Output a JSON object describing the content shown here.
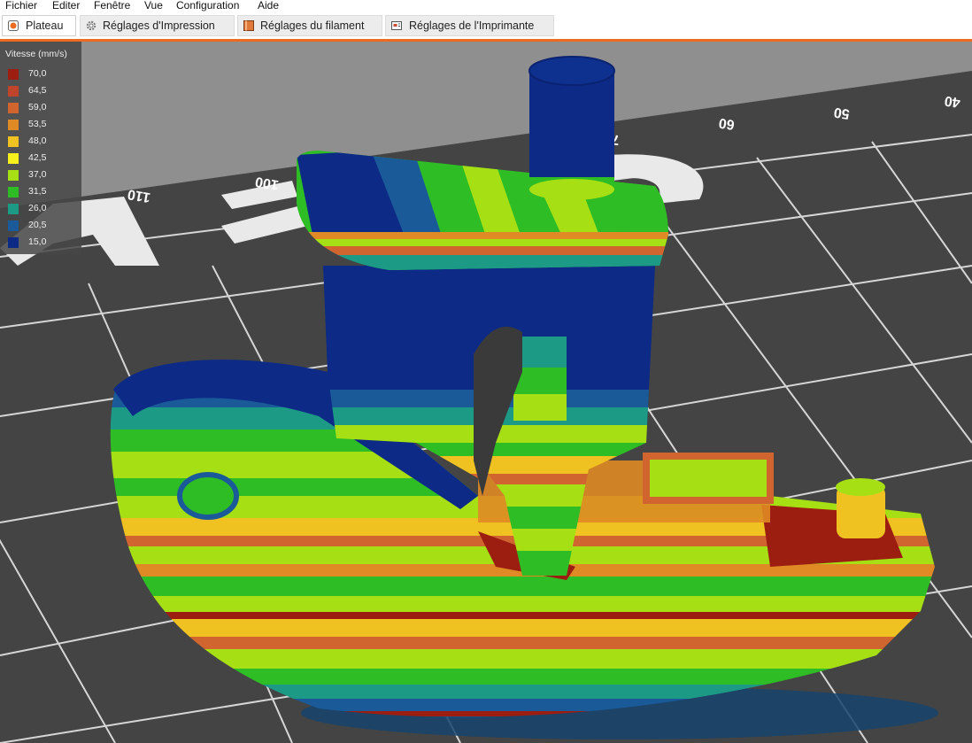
{
  "menu": [
    "Fichier",
    "Editer",
    "Fenêtre",
    "Vue",
    "Configuration",
    "Aide"
  ],
  "tabs": [
    {
      "label": "Plateau",
      "icon": "plater-icon",
      "active": true
    },
    {
      "label": "Réglages d'Impression",
      "icon": "print-settings-gear-icon",
      "active": false
    },
    {
      "label": "Réglages du filament",
      "icon": "filament-spool-icon",
      "active": false
    },
    {
      "label": "Réglages de l'Imprimante",
      "icon": "printer-settings-icon",
      "active": false
    }
  ],
  "accent_color": "#ed6b21",
  "legend": {
    "title": "Vitesse (mm/s)",
    "items": [
      {
        "value": "70,0",
        "color": "#9b1e10"
      },
      {
        "value": "64,5",
        "color": "#c0432b"
      },
      {
        "value": "59,0",
        "color": "#d16530"
      },
      {
        "value": "53,5",
        "color": "#e08a25"
      },
      {
        "value": "48,0",
        "color": "#efc222"
      },
      {
        "value": "42,5",
        "color": "#f6f11c"
      },
      {
        "value": "37,0",
        "color": "#a6e014"
      },
      {
        "value": "31,5",
        "color": "#2fbd26"
      },
      {
        "value": "26,0",
        "color": "#1d9a86"
      },
      {
        "value": "20,5",
        "color": "#1a5a99"
      },
      {
        "value": "15,0",
        "color": "#0c2a86"
      }
    ]
  },
  "bed_labels": [
    "110",
    "100",
    "70",
    "60",
    "50",
    "40"
  ]
}
